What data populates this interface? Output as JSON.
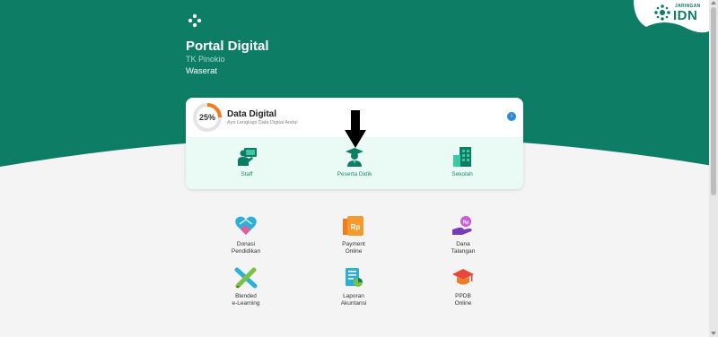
{
  "header": {
    "page_title": "Portal Digital",
    "school_name": "TK Pinokio",
    "user_name": "Waserat",
    "brand_small": "JARINGAN",
    "brand_big": "IDN"
  },
  "data_digital": {
    "progress_percent": 25,
    "progress_label": "25%",
    "title": "Data Digital",
    "subtitle": "Ayo Lengkapi Data Digital Anda!",
    "chevron": "›"
  },
  "categories": [
    {
      "label": "Staff",
      "icon": "staff-icon"
    },
    {
      "label": "Peserta Didik",
      "icon": "student-icon"
    },
    {
      "label": "Sekolah",
      "icon": "school-icon"
    }
  ],
  "menu": [
    {
      "label": "Donasi\nPendidikan",
      "icon": "donation-heart-icon"
    },
    {
      "label": "Payment\nOnline",
      "icon": "payment-rp-icon"
    },
    {
      "label": "Dana\nTalangan",
      "icon": "loan-hand-icon"
    },
    {
      "label": "Blended\ne-Learning",
      "icon": "ruler-pencil-icon"
    },
    {
      "label": "Laporan\nAkuntansi",
      "icon": "accounting-report-icon"
    },
    {
      "label": "PPDB\nOnline",
      "icon": "graduation-cap-icon"
    }
  ],
  "colors": {
    "primary": "#0e7d66",
    "card_bottom": "#e9fbf4",
    "progress": "#f07c22",
    "chevron": "#2a8bd6"
  }
}
